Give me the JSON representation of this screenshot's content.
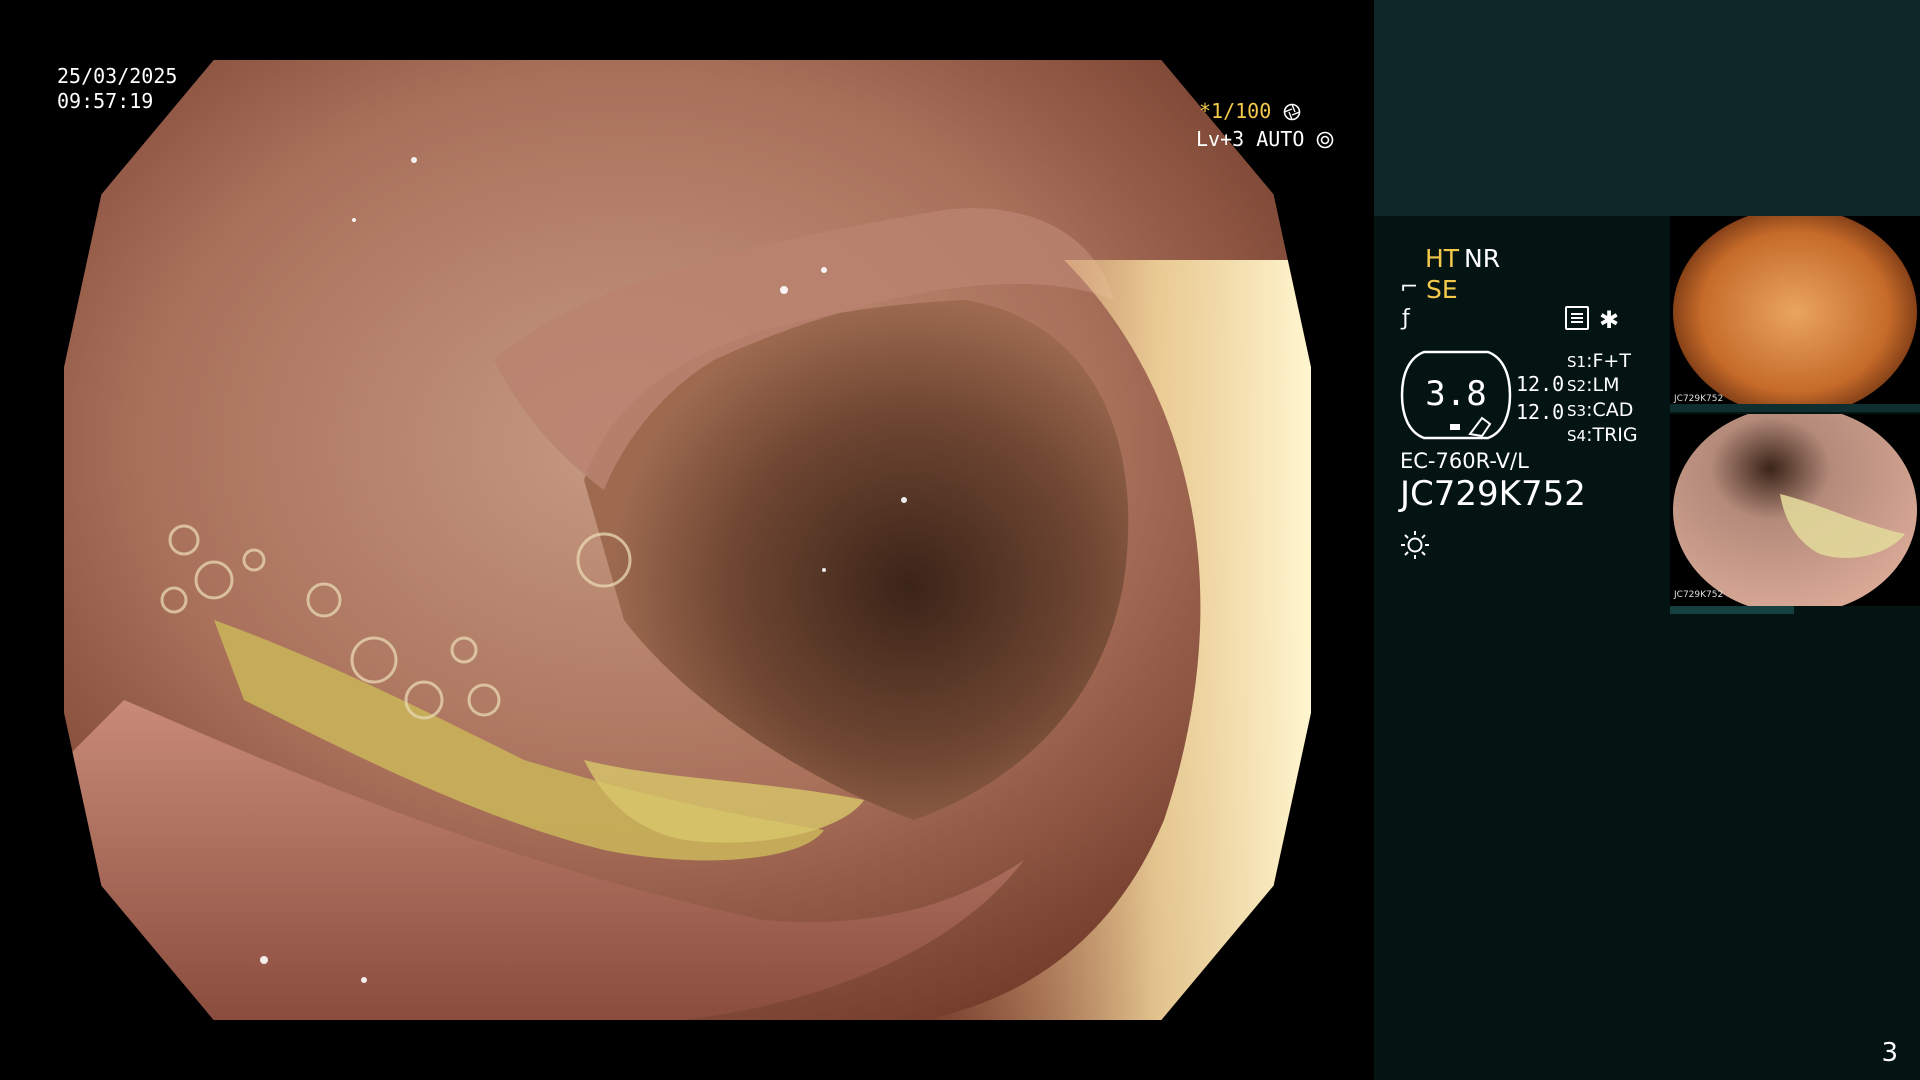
{
  "overlay": {
    "date": "25/03/2025",
    "time": "09:57:19",
    "exposure": "*1/100",
    "level": "Lv+3 AUTO"
  },
  "panel": {
    "ht": "HT",
    "nr": "NR",
    "se": "SE",
    "magnification": "3.8",
    "mag_a": "12.0",
    "mag_b": "12.0",
    "switches": [
      {
        "key": "S1",
        "value": "F+T"
      },
      {
        "key": "S2",
        "value": "LM"
      },
      {
        "key": "S3",
        "value": "CAD"
      },
      {
        "key": "S4",
        "value": "TRIG"
      }
    ],
    "model": "EC-760R-V/L",
    "serial": "JC729K752"
  },
  "thumbnails": [
    {
      "label": "JC729K752"
    },
    {
      "label": "JC729K752"
    }
  ],
  "page_number": "3",
  "icons": [
    "aperture-icon",
    "iris-icon",
    "scope-tip-icon",
    "flash-icon",
    "memo-icon",
    "sun-icon"
  ],
  "colors": {
    "accent_yellow": "#f4c84a",
    "panel_dark": "#041413",
    "panel_top": "#0e2627"
  }
}
